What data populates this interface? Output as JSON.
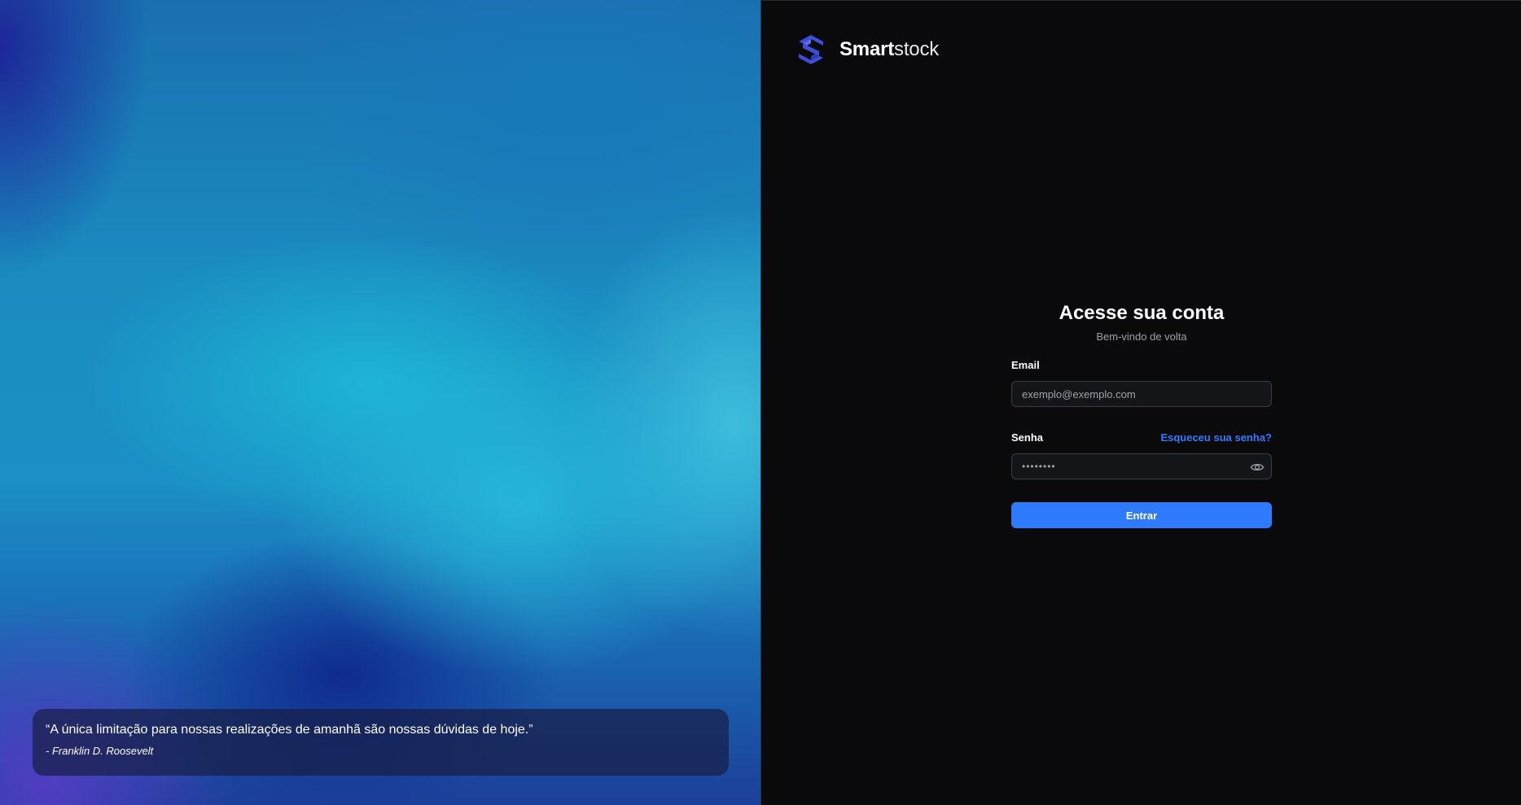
{
  "hero": {
    "quote": "“A única limitação para nossas realizações de amanhã são nossas dúvidas de hoje.”",
    "author": "- Franklin D. Roosevelt"
  },
  "brand": {
    "name_bold": "Smart",
    "name_light": "stock",
    "logo_icon": "smartstock-s-logo-icon",
    "logo_color": "#3b4fd8"
  },
  "login": {
    "title": "Acesse sua conta",
    "subtitle": "Bem-vindo de volta",
    "email_label": "Email",
    "email_placeholder": "exemplo@exemplo.com",
    "email_value": "",
    "password_label": "Senha",
    "forgot_link": "Esqueceu sua senha?",
    "password_placeholder": "••••••••",
    "password_value": "",
    "show_password_icon": "eye-icon",
    "submit_label": "Entrar"
  },
  "colors": {
    "accent": "#2f7bff",
    "panel_background": "#0a0a0c",
    "input_background": "#141518"
  }
}
